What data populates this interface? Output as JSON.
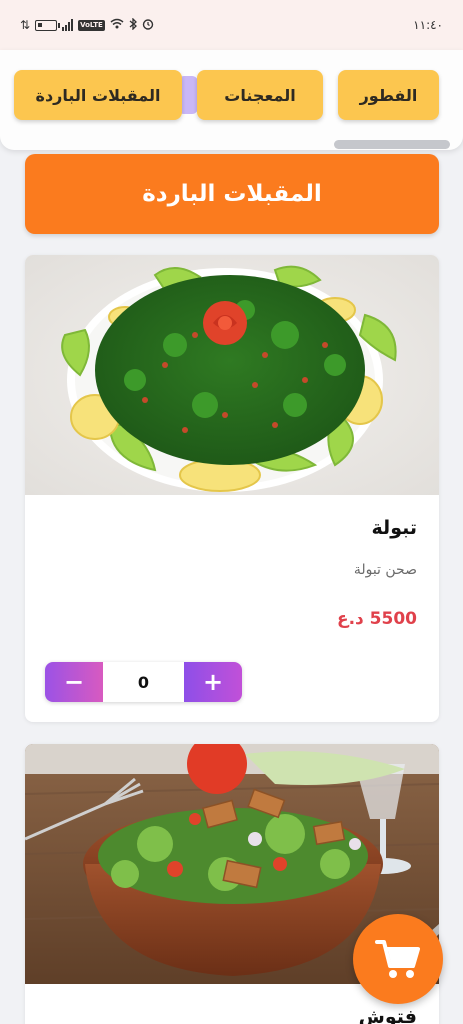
{
  "status_bar": {
    "time": "١١:٤٠",
    "network_badge": "VoLTE"
  },
  "categories": [
    {
      "label": "الفطور"
    },
    {
      "label": "المعجنات"
    },
    {
      "label": "المقبلات الباردة"
    }
  ],
  "section": {
    "title": "المقبلات الباردة"
  },
  "products": [
    {
      "name": "تبولة",
      "description": "صحن تبولة",
      "price": "5500 د.ع",
      "quantity": "0",
      "minus_label": "−",
      "plus_label": "+"
    },
    {
      "name": "فتوش"
    }
  ],
  "colors": {
    "accent_orange": "#fb7b1e",
    "tab_yellow": "#fcc64f",
    "price_red": "#e0414b",
    "stepper_purple": "#9b52e6"
  },
  "icons": {
    "cart": "shopping-cart-icon",
    "minus": "minus-icon",
    "plus": "plus-icon"
  }
}
